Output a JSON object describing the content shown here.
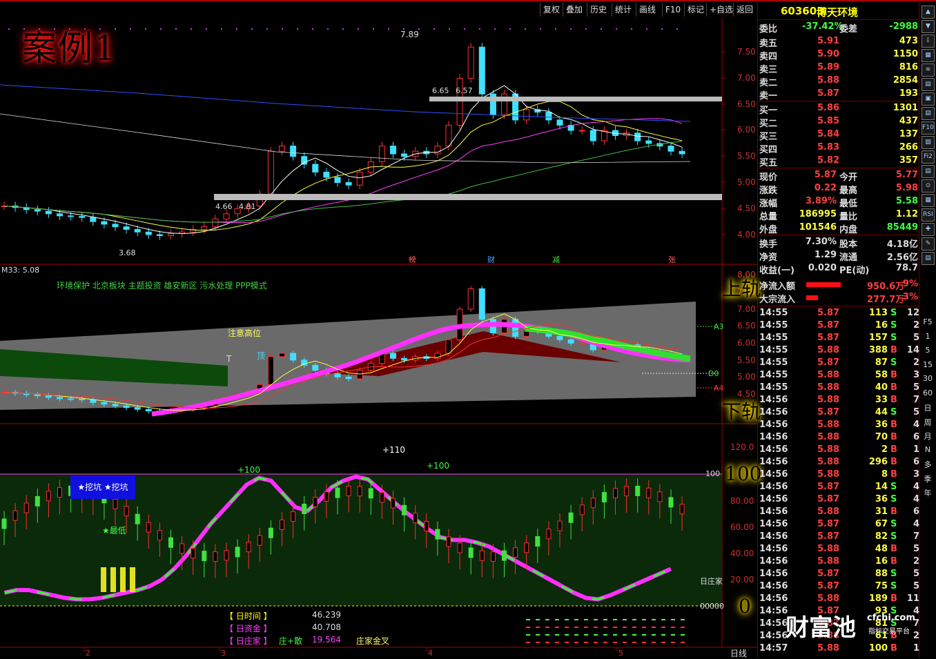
{
  "toolbar": [
    "复权",
    "叠加",
    "历史",
    "统计",
    "画线",
    "F10",
    "标记",
    "+自选",
    "返回"
  ],
  "overlay": {
    "case_label": "案例1",
    "upper_rail": "上轨",
    "lower_rail": "下轨",
    "level_100": "100",
    "level_0": "0"
  },
  "stock": {
    "code": "603603",
    "name": "博天环境"
  },
  "weibi": {
    "label1": "委比",
    "value1": "-37.42%",
    "label2": "委差",
    "value2": "-2988"
  },
  "asks": [
    {
      "label": "卖五",
      "price": "5.91",
      "vol": "473"
    },
    {
      "label": "卖四",
      "price": "5.90",
      "vol": "1150"
    },
    {
      "label": "卖三",
      "price": "5.89",
      "vol": "816"
    },
    {
      "label": "卖二",
      "price": "5.88",
      "vol": "2854"
    },
    {
      "label": "卖一",
      "price": "5.87",
      "vol": "193"
    }
  ],
  "bids": [
    {
      "label": "买一",
      "price": "5.86",
      "vol": "1301"
    },
    {
      "label": "买二",
      "price": "5.85",
      "vol": "437"
    },
    {
      "label": "买三",
      "price": "5.84",
      "vol": "137"
    },
    {
      "label": "买四",
      "price": "5.83",
      "vol": "266"
    },
    {
      "label": "买五",
      "price": "5.82",
      "vol": "357"
    }
  ],
  "stats": [
    {
      "l1": "现价",
      "v1": "5.87",
      "l2": "今开",
      "v2": "5.77"
    },
    {
      "l1": "涨跌",
      "v1": "0.22",
      "l2": "最高",
      "v2": "5.98"
    },
    {
      "l1": "涨幅",
      "v1": "3.89%",
      "l2": "最低",
      "v2": "5.58"
    },
    {
      "l1": "总量",
      "v1": "186995",
      "l2": "量比",
      "v2": "1.12"
    },
    {
      "l1": "外盘",
      "v1": "101546",
      "l2": "内盘",
      "v2": "85449"
    }
  ],
  "stats2": [
    {
      "l1": "换手",
      "v1": "7.30%",
      "l2": "股本",
      "v2": "4.18亿"
    },
    {
      "l1": "净资",
      "v1": "1.29",
      "l2": "流通",
      "v2": "2.56亿"
    },
    {
      "l1": "收益(一)",
      "v1": "0.020",
      "l2": "PE(动)",
      "v2": "78.7"
    }
  ],
  "flows": [
    {
      "label": "净流入额",
      "value": "950.6万",
      "pct": "9%",
      "bar": 0.9
    },
    {
      "label": "大宗流入",
      "value": "277.7万",
      "pct": "3%",
      "bar": 0.3
    }
  ],
  "ticks": [
    [
      "14:55",
      "5.87",
      "113",
      "S",
      "12"
    ],
    [
      "14:55",
      "5.87",
      "16",
      "S",
      "2"
    ],
    [
      "14:55",
      "5.87",
      "157",
      "S",
      "5"
    ],
    [
      "14:55",
      "5.88",
      "388",
      "B",
      "14"
    ],
    [
      "14:55",
      "5.87",
      "87",
      "S",
      "2"
    ],
    [
      "14:55",
      "5.88",
      "58",
      "B",
      "3"
    ],
    [
      "14:55",
      "5.88",
      "40",
      "B",
      "5"
    ],
    [
      "14:56",
      "5.88",
      "33",
      "B",
      "7"
    ],
    [
      "14:56",
      "5.87",
      "44",
      "S",
      "5"
    ],
    [
      "14:56",
      "5.88",
      "36",
      "B",
      "4"
    ],
    [
      "14:56",
      "5.88",
      "70",
      "B",
      "6"
    ],
    [
      "14:56",
      "5.88",
      "2",
      "B",
      "1"
    ],
    [
      "14:56",
      "5.88",
      "296",
      "B",
      "6"
    ],
    [
      "14:56",
      "5.88",
      "8",
      "B",
      "3"
    ],
    [
      "14:56",
      "5.87",
      "14",
      "S",
      "4"
    ],
    [
      "14:56",
      "5.87",
      "36",
      "S",
      "4"
    ],
    [
      "14:56",
      "5.88",
      "31",
      "B",
      "6"
    ],
    [
      "14:56",
      "5.87",
      "67",
      "S",
      "4"
    ],
    [
      "14:56",
      "5.87",
      "82",
      "S",
      "7"
    ],
    [
      "14:56",
      "5.88",
      "48",
      "B",
      "5"
    ],
    [
      "14:56",
      "5.88",
      "16",
      "B",
      "2"
    ],
    [
      "14:56",
      "5.87",
      "88",
      "S",
      "5"
    ],
    [
      "14:56",
      "5.87",
      "75",
      "S",
      "5"
    ],
    [
      "14:56",
      "5.88",
      "189",
      "B",
      "11"
    ],
    [
      "14:56",
      "5.87",
      "93",
      "S",
      "4"
    ],
    [
      "14:56",
      "5.87",
      "81",
      "S",
      "7"
    ],
    [
      "14:56",
      "5.88",
      "61",
      "B",
      "2"
    ],
    [
      "14:57",
      "5.88",
      "100",
      "B",
      "1"
    ]
  ],
  "right_icons": [
    "▲",
    "▼",
    "⇩",
    "▦",
    "≋",
    "▤",
    "▣",
    "▤",
    "F10",
    "▨",
    "Fi2",
    "▤",
    "⊙",
    "▦",
    "RSI",
    "✚",
    "✎",
    "▤"
  ],
  "right_tabs": [
    "F5",
    "1",
    "5",
    "15",
    "30",
    "60",
    "日",
    "周",
    "月",
    "N",
    "多",
    "季",
    "年"
  ],
  "main_panel": {
    "y_labels": [
      "7.50",
      "7.00",
      "6.50",
      "6.00",
      "5.50",
      "5.00",
      "4.50",
      "4.00"
    ],
    "annotations": [
      "7.89",
      "6.65",
      "6.57",
      "4.66",
      "4.81",
      "3.68"
    ],
    "event_marks": [
      {
        "text": "榜",
        "color": "#ff6060"
      },
      {
        "text": "财",
        "color": "#4fa0ff"
      },
      {
        "text": "减",
        "color": "#40e040"
      },
      {
        "text": "张",
        "color": "#ff6060"
      }
    ]
  },
  "mid_panel": {
    "title": "M33: 5.08",
    "concepts": "环境保护 北京板块 主题投资 雄安新区 污水处理 PPP模式",
    "note": "注意高位",
    "y_labels": [
      "8.00",
      "7.50",
      "7.00",
      "6.50",
      "6.00",
      "5.50",
      "5.00",
      "4.50"
    ],
    "right_marks": [
      "A3",
      "D0",
      "A4"
    ],
    "top_marks": [
      "T",
      "顶"
    ]
  },
  "low_panel": {
    "y_labels": [
      "120.0",
      "100.0",
      "80.00",
      "60.00",
      "40.00",
      "20.00"
    ],
    "marks": [
      "+110",
      "+100",
      "+100"
    ],
    "buy_box": "★挖坑 ★挖坑",
    "lowest": "★最低",
    "right_label_100": "100",
    "right_label_zj": "日庄家",
    "right_label_zero": "00000",
    "legend": [
      {
        "label": "【 日时间 】",
        "value": "46.239",
        "color": "#ffff00"
      },
      {
        "label": "【 日资金 】",
        "value": "40.708",
        "color": "#ff40ff"
      },
      {
        "label": "【 日庄家 】",
        "value": "19.564",
        "color": "#ff40ff"
      }
    ],
    "legend_extra1": "庄+散",
    "legend_extra2": "庄家金叉",
    "x_labels": [
      "2",
      "3",
      "4",
      "5"
    ],
    "period_label": "日线"
  },
  "watermark": {
    "name": "财富池",
    "url": "cfchi.com",
    "sub": "指标交易平台"
  }
}
